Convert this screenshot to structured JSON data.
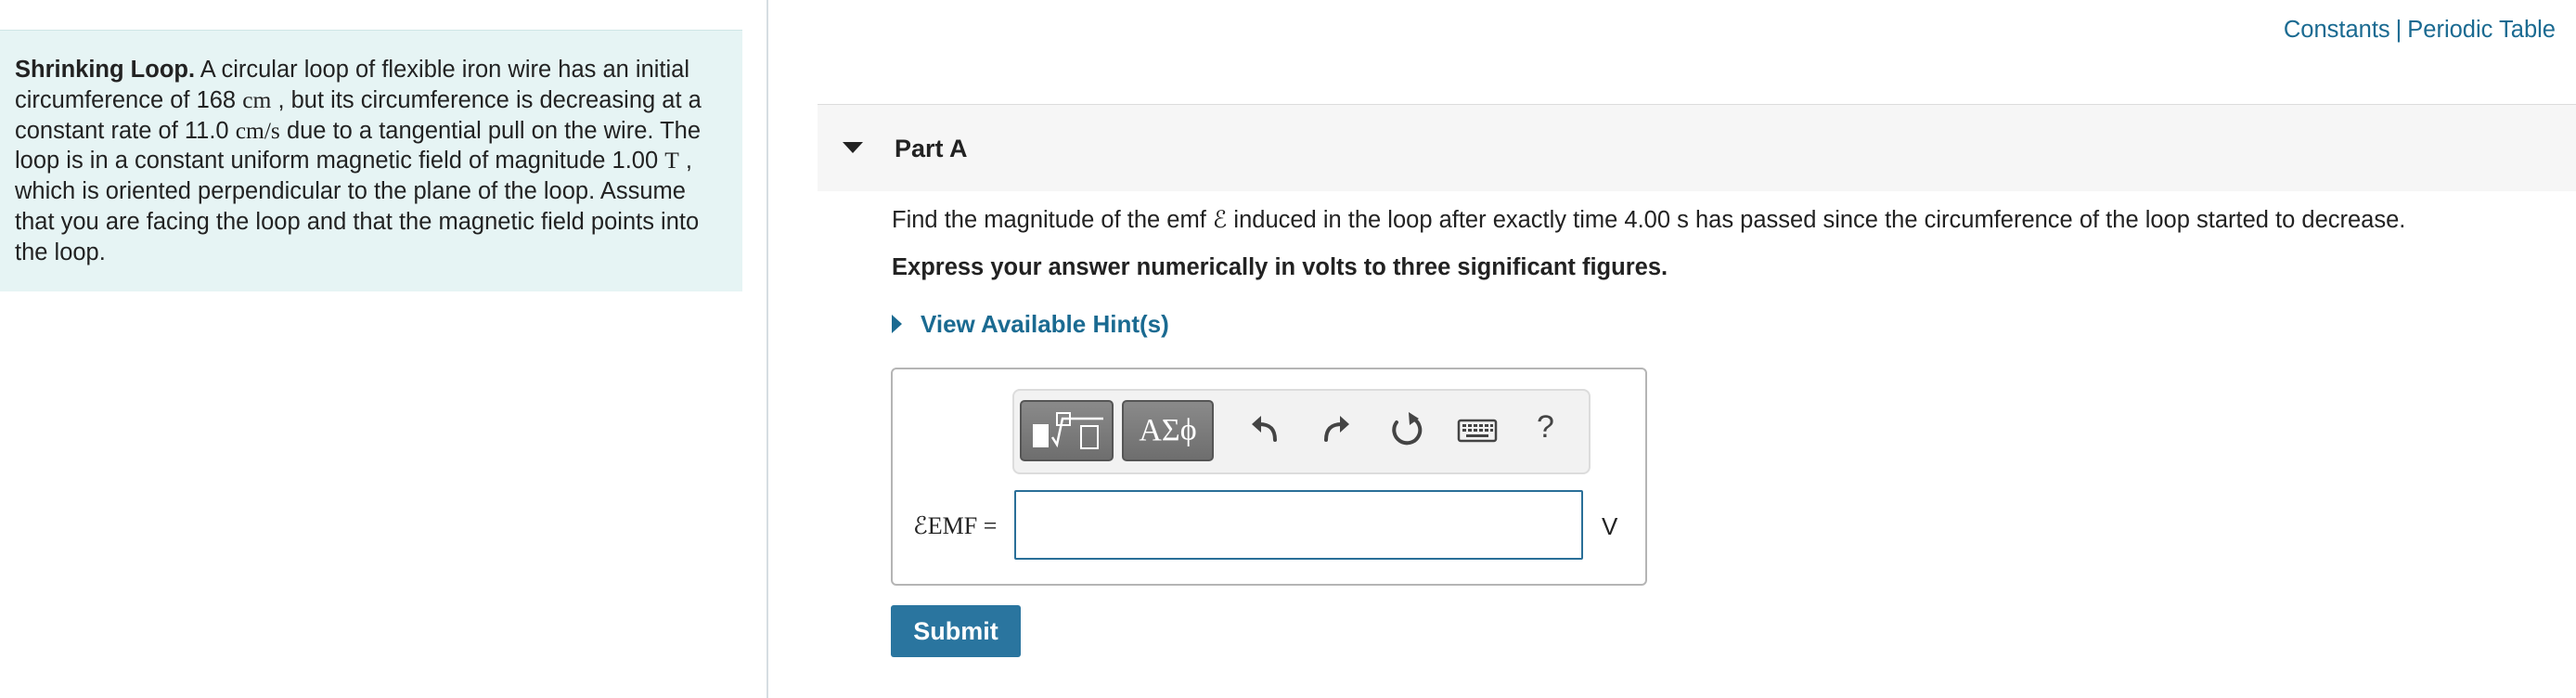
{
  "header": {
    "link_constants": "Constants",
    "separator": "|",
    "link_periodic_table": "Periodic Table"
  },
  "problem": {
    "title": "Shrinking Loop.",
    "text_1": " A circular loop of flexible iron wire has an initial circumference of 168 ",
    "unit_cm_1": "cm",
    "text_2": " , but its circumference is decreasing at a constant rate of 11.0 ",
    "unit_rate": "cm/s",
    "text_3": " due to a tangential pull on the wire. The loop is in a constant uniform magnetic field of magnitude 1.00 ",
    "unit_T": "T",
    "text_4": " , which is oriented perpendicular to the plane of the loop. Assume that you are facing the loop and that the magnetic field points into the loop."
  },
  "part": {
    "title": "Part A",
    "question_1": "Find the magnitude of the emf ",
    "question_symbol": "ℰ",
    "question_2": " induced in the loop after exactly time 4.00 s has passed since the circumference of the loop started to decrease.",
    "instruction": "Express your answer numerically in volts to three significant figures.",
    "hint_label": "View Available Hint(s)"
  },
  "answer": {
    "label": "ℰEMF =",
    "value": "",
    "unit": "V",
    "toolbar": {
      "templates_icon": "templates-icon",
      "symbols_label": "ΑΣϕ",
      "undo_icon": "undo-icon",
      "redo_icon": "redo-icon",
      "reset_icon": "reset-icon",
      "keyboard_icon": "keyboard-icon",
      "help_label": "?"
    }
  },
  "submit_label": "Submit",
  "colors": {
    "link": "#1a6a91",
    "panel_bg": "#e6f4f4",
    "submit_bg": "#2a759f",
    "input_border": "#2a6f98"
  }
}
